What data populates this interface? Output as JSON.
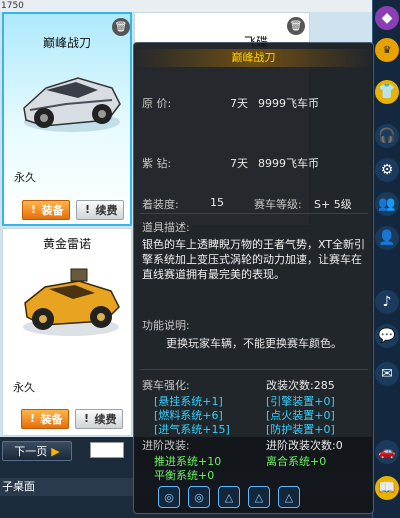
{
  "top_counter": "1750",
  "cards": [
    {
      "title": "巅峰战刀",
      "duration": "永久",
      "equip": "装备",
      "renew": "续费",
      "selected": true
    },
    {
      "title": "飞碟",
      "duration": "",
      "equip": "",
      "renew": "",
      "selected": false
    },
    {
      "title": "黄金雷诺",
      "duration": "永久",
      "equip": "装备",
      "renew": "续费",
      "selected": false
    }
  ],
  "nav": {
    "next_label": "下一页",
    "desk_label": "子桌面"
  },
  "tooltip": {
    "title": "巅峰战刀",
    "price_label": "原  价:",
    "price_days": "7天",
    "price_value": "9999飞车币",
    "vip_label": "紫  钻:",
    "vip_days": "7天",
    "vip_value": "8999飞车币",
    "wear_label": "着装度:",
    "wear_value": "15",
    "grade_label": "赛车等级:",
    "grade_value": "S+ 5级",
    "desc_label": "道具描述:",
    "desc_text": "银色的车上透睥睨万物的王者气势，XT全新引擎系统加上变压式涡轮的动力加速，让赛车在直线赛道拥有最完美的表现。",
    "note_label": "功能说明:",
    "note_text": "更换玩家车辆，不能更换赛车颜色。",
    "enhance_label": "赛车强化:",
    "modify_count_label": "改装次数:285",
    "enhance_items": [
      "[悬挂系统+1]",
      "[引擎装置+0]",
      "[燃料系统+6]",
      "[点火装置+0]",
      "[进气系统+15]",
      "[防护装置+0]"
    ],
    "advanced_label": "进阶改装:",
    "advanced_count_label": "进阶改装次数:0",
    "advanced_items": [
      "推进系统+10",
      "离合系统+0",
      "平衡系统+0"
    ]
  },
  "right_icons": [
    "gem-icon",
    "vip-icon",
    "shirt-icon",
    "headset-icon",
    "gear-icon",
    "friends-icon",
    "person-icon",
    "music-icon",
    "chat-icon",
    "mail-icon",
    "car-icon",
    "book-icon"
  ]
}
